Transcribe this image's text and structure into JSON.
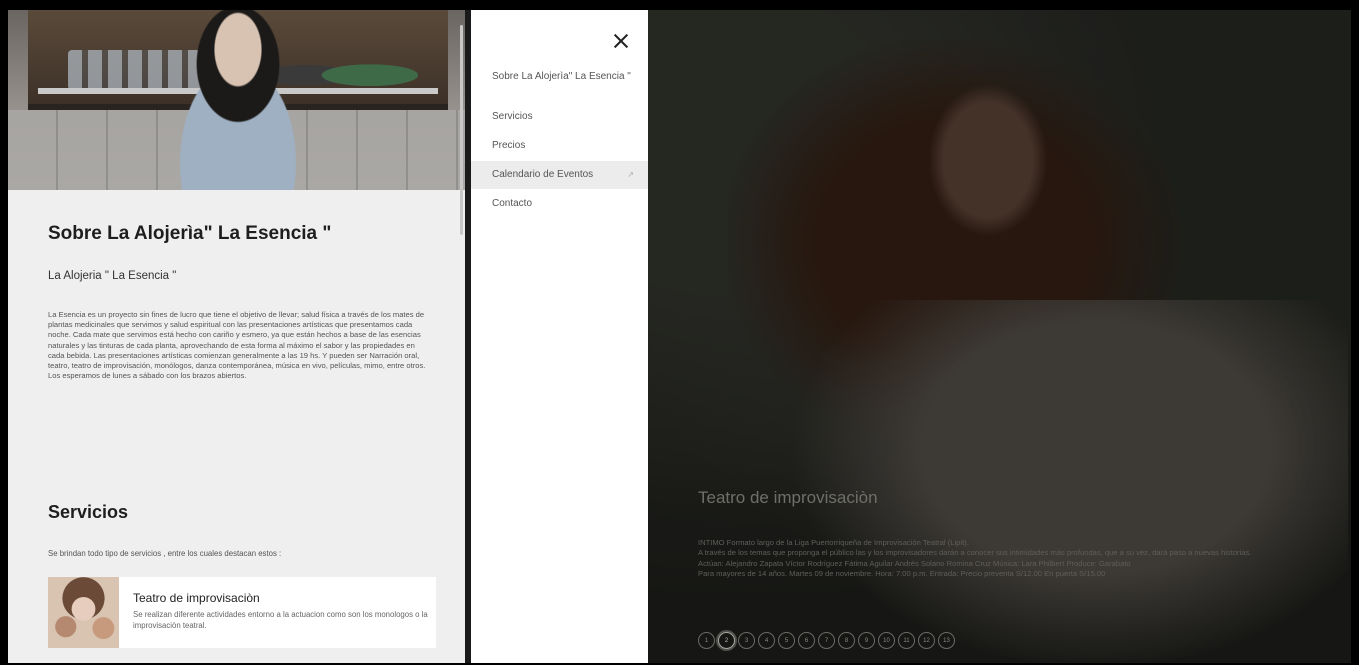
{
  "about": {
    "title": "Sobre La Alojerìa\" La Esencia \"",
    "subtitle": "La Alojeria \" La Esencia \"",
    "paragraph": "La Esencia es un proyecto sin fines de lucro que tiene el objetivo de llevar; salud física a través de los mates de plantas medicinales que servimos y salud espiritual con las presentaciones artísticas que presentamos cada noche. Cada mate que servimos está hecho con cariño y esmero, ya que están hechos a base de las esencias naturales y las tinturas de cada planta, aprovechando de esta forma al máximo el sabor y las propiedades en cada bebida. Las presentaciones artísticas comienzan generalmente a las 19 hs. Y pueden ser Narración oral, teatro, teatro de improvisación, monólogos, danza contemporánea, música en vivo, películas, mimo, entre otros. Los esperamos de lunes a sábado con los brazos abiertos."
  },
  "services": {
    "title": "Servicios",
    "subtitle": "Se brindan todo tipo de servicios , entre los cuales destacan estos :",
    "items": [
      {
        "title": "Teatro de improvisaciòn",
        "description": "Se realizan diferente actividades entorno a la actuacion como son los monologos o la improvisaciòn teatral."
      }
    ]
  },
  "menu": {
    "items": [
      {
        "label": "Sobre La Alojerìa\" La Esencia \""
      },
      {
        "label": "Servicios"
      },
      {
        "label": "Precios"
      },
      {
        "label": "Calendario de Eventos"
      },
      {
        "label": "Contacto"
      }
    ],
    "active_index": 3
  },
  "slider": {
    "title": "Teatro de improvisaciòn",
    "lines": [
      "INTIMO Formato largo de la Liga Puertorriqueña de Improvisación Teatral (Lipit).",
      "A través de los temas que proponga el público las y los improvisadores darán a conocer sus intimidades más profundas, que a su vez, dará paso a nuevas historias.",
      "Actúan: Alejandro Zapata Víctor Rodríguez Fátima Aguilar Andrés Solano Romina Cruz Música: Lara Philbert Produce: Garabato",
      "Para mayores de 14 años. Martes 09 de noviembre. Hora: 7:00 p.m. Entrada: Precio preventa S/12.00 En puerta S/15.00"
    ],
    "pages": [
      "1",
      "2",
      "3",
      "4",
      "5",
      "6",
      "7",
      "8",
      "9",
      "10",
      "11",
      "12",
      "13"
    ],
    "active_page": "2"
  },
  "icons": {
    "close": "close-icon",
    "external": "external-link-icon"
  }
}
